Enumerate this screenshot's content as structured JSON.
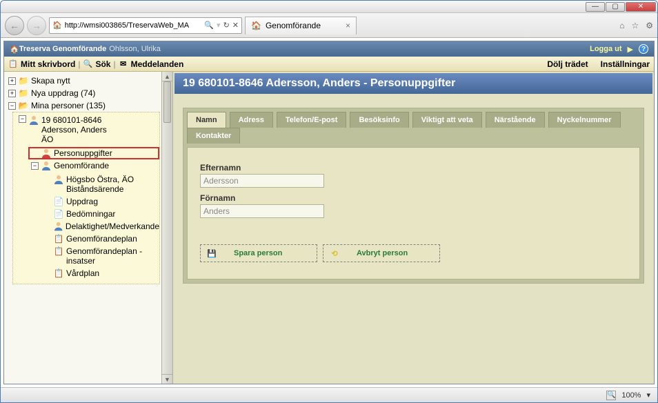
{
  "window": {
    "url": "http://wmsi003865/TreservaWeb_MA",
    "tab_title": "Genomförande"
  },
  "app": {
    "title": "Treserva Genomförande",
    "user": "Ohlsson, Ulrika",
    "logout": "Logga ut",
    "toolbar": {
      "desk": "Mitt skrivbord",
      "search": "Sök",
      "messages": "Meddelanden",
      "hide_tree": "Dölj trädet",
      "settings": "Inställningar"
    }
  },
  "tree": {
    "n1": "Skapa nytt",
    "n2": "Nya uppdrag (74)",
    "n3": "Mina personer (135)",
    "p1_line1": "19 680101-8646",
    "p1_line2": "Adersson, Anders",
    "p1_line3": "ÄO",
    "personuppgifter": "Personuppgifter",
    "genomforande": "Genomförande",
    "g_sub1_l1": "Högsbo Östra, ÄO",
    "g_sub1_l2": "Biståndsärende",
    "uppdrag": "Uppdrag",
    "bedomningar": "Bedömningar",
    "delaktighet": "Delaktighet/Medverkande",
    "gplan": "Genomförandeplan",
    "gplan_i1": "Genomförandeplan -",
    "gplan_i2": "insatser",
    "vardplan": "Vårdplan"
  },
  "page": {
    "heading": "19 680101-8646 Adersson, Anders - Personuppgifter",
    "tabs": {
      "namn": "Namn",
      "adress": "Adress",
      "tel": "Telefon/E-post",
      "besok": "Besöksinfo",
      "viktigt": "Viktigt att veta",
      "nar": "Närstående",
      "nyckel": "Nyckelnummer",
      "kontakter": "Kontakter"
    },
    "form": {
      "lastname_label": "Efternamn",
      "lastname_value": "Adersson",
      "firstname_label": "Förnamn",
      "firstname_value": "Anders"
    },
    "buttons": {
      "save": "Spara person",
      "cancel": "Avbryt person"
    }
  },
  "status": {
    "zoom": "100%"
  }
}
